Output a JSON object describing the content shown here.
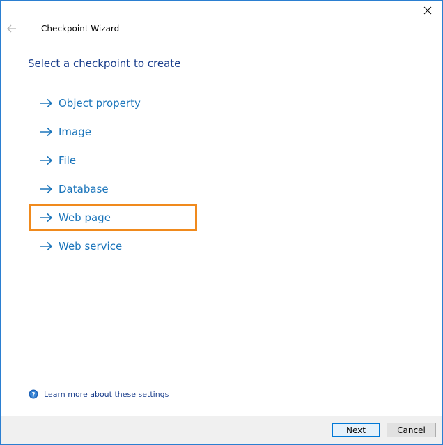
{
  "window": {
    "title": "Checkpoint Wizard"
  },
  "header": {
    "heading": "Select a checkpoint to create"
  },
  "options": [
    {
      "label": "Object property",
      "selected": false
    },
    {
      "label": "Image",
      "selected": false
    },
    {
      "label": "File",
      "selected": false
    },
    {
      "label": "Database",
      "selected": false
    },
    {
      "label": "Web page",
      "selected": true
    },
    {
      "label": "Web service",
      "selected": false
    }
  ],
  "help": {
    "link_text": "Learn more about these settings",
    "icon": "help-icon"
  },
  "footer": {
    "next_label": "Next",
    "cancel_label": "Cancel"
  },
  "colors": {
    "accent": "#1b75bb",
    "selected_border": "#f08a1d",
    "window_border": "#2b7fd1"
  }
}
